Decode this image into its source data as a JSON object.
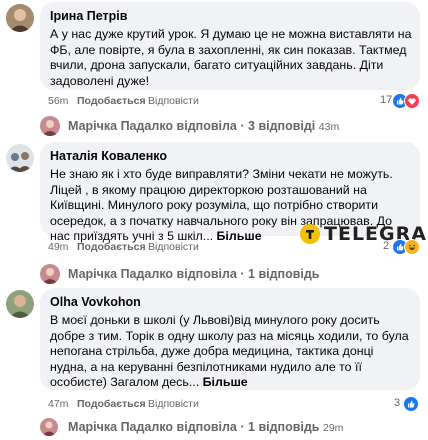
{
  "comments": [
    {
      "author": "Ірина Петрів",
      "text": "А у нас дуже крутий урок. Я думаю це не можна виставляти на ФБ, але повірте, я була в захопленні, як син показав. Тактмед вчили, дрона запускали, багато ситуаційних завдань. Діти задоволені дуже!",
      "more": "",
      "time": "56m",
      "like": "Подобається",
      "reply": "Відповісти",
      "reaction_count": "17"
    },
    {
      "author": "Наталія Коваленко",
      "text": "Не знаю як і хто буде виправляти? Зміни чекати не можуть. Ліцей , в якому працюю директоркою розташований на Київщині. Минулого року розуміла, що потрібно створити осередок, а з початку навчального року він запрацював. До нас приїздять учні з 5 шкіл...",
      "more": "Більше",
      "time": "49m",
      "like": "Подобається",
      "reply": "Відповісти",
      "reaction_count": "2"
    },
    {
      "author": "Olha Vovkohon",
      "text": "В моєї доньки в школі (у Львові)від минулого року досить добре з тим. Торік в одну школу раз на місяць ходили, то була непогана стрільба, дуже добра медицина, тактика донці нудна, а на керуванні безпілотниками нудило але то її особисте) Загалом десь...",
      "more": "Більше",
      "time": "47m",
      "like": "Подобається",
      "reply": "Відповісти",
      "reaction_count": "3"
    }
  ],
  "replies": [
    {
      "author": "Марічка Падалко",
      "action": "відповіла",
      "count": "3 відповіді",
      "time": "43m"
    },
    {
      "author": "Марічка Падалко",
      "action": "відповіла",
      "count": "1 відповідь",
      "time": ""
    },
    {
      "author": "Марічка Падалко",
      "action": "відповіла",
      "count": "1 відповідь",
      "time": "29m"
    }
  ],
  "separator": "·",
  "watermark": {
    "brand": "TELEGRAF"
  },
  "colors": {
    "bubble": "#f0f2f5",
    "meta": "#65676b",
    "like_blue": "#1877f2",
    "love_red": "#f33e58",
    "haha_yellow": "#f7b125"
  },
  "icons": [
    "like-icon",
    "love-icon",
    "haha-icon",
    "reply-arrow-icon",
    "telegraf-logo-icon"
  ]
}
